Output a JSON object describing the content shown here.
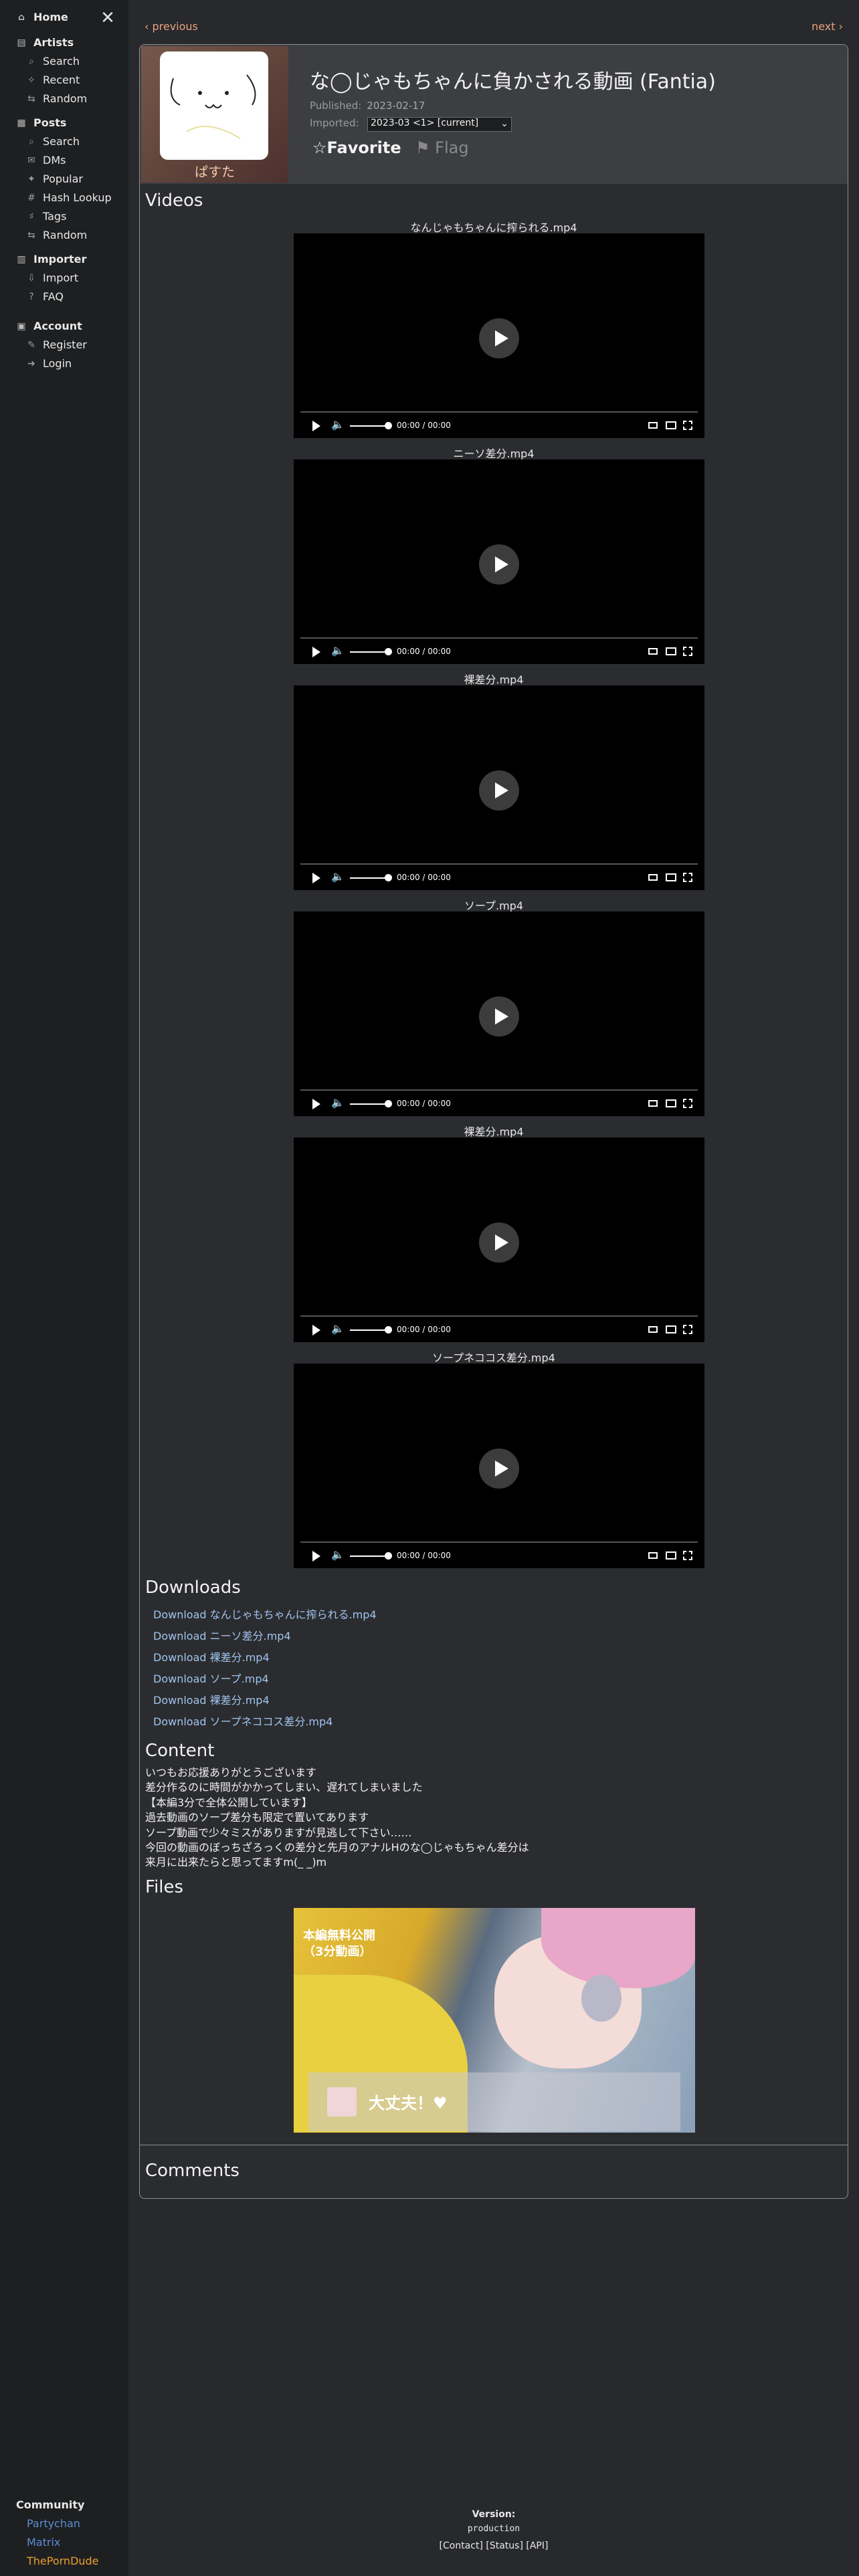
{
  "sidebar": {
    "home": "Home",
    "artists": {
      "label": "Artists",
      "items": [
        "Search",
        "Recent",
        "Random"
      ]
    },
    "posts": {
      "label": "Posts",
      "items": [
        "Search",
        "DMs",
        "Popular",
        "Hash Lookup",
        "Tags",
        "Random"
      ]
    },
    "importer": {
      "label": "Importer",
      "items": [
        "Import",
        "FAQ"
      ]
    },
    "account": {
      "label": "Account",
      "items": [
        "Register",
        "Login"
      ]
    },
    "community": {
      "label": "Community",
      "links": [
        {
          "label": "Partychan",
          "color": "#5a8ed6"
        },
        {
          "label": "Matrix",
          "color": "#5a8ed6"
        },
        {
          "label": "ThePornDude",
          "color": "#e8a030"
        }
      ]
    }
  },
  "nav": {
    "previous": "‹ previous",
    "next": "next ›"
  },
  "post": {
    "artist_name": "ぱすた",
    "title": "な◯じゃもちゃんに負かされる動画 (Fantia)",
    "published_label": "Published:",
    "published_date": "2023-02-17",
    "imported_label": "Imported:",
    "imported_value": "2023-03 <1> [current]",
    "favorite_label": "☆Favorite",
    "flag_label": "⚑ Flag"
  },
  "videos_heading": "Videos",
  "videos": [
    {
      "title": "なんじゃもちゃんに搾られる.mp4",
      "time": "00:00 / 00:00"
    },
    {
      "title": "ニーソ差分.mp4",
      "time": "00:00 / 00:00"
    },
    {
      "title": "裸差分.mp4",
      "time": "00:00 / 00:00"
    },
    {
      "title": "ソープ.mp4",
      "time": "00:00 / 00:00"
    },
    {
      "title": "裸差分.mp4",
      "time": "00:00 / 00:00"
    },
    {
      "title": "ソープネココス差分.mp4",
      "time": "00:00 / 00:00"
    }
  ],
  "downloads_heading": "Downloads",
  "downloads": [
    "Download なんじゃもちゃんに搾られる.mp4",
    "Download ニーソ差分.mp4",
    "Download 裸差分.mp4",
    "Download ソープ.mp4",
    "Download 裸差分.mp4",
    "Download ソープネココス差分.mp4"
  ],
  "content_heading": "Content",
  "content_lines": [
    "いつもお応援ありがとうございます",
    "差分作るのに時間がかかってしまい、遅れてしまいました",
    "【本編3分で全体公開しています】",
    "過去動画のソープ差分も限定で置いてあります",
    "ソープ動画で少々ミスがありますが見逃して下さい……",
    "今回の動画のぼっちざろっくの差分と先月のアナルHのな◯じゃもちゃん差分は",
    "来月に出来たらと思ってますm(_ _)m"
  ],
  "files_heading": "Files",
  "file_thumb": {
    "caption_line1": "本編無料公開",
    "caption_line2": "（3分動画）",
    "banner_text": "大丈夫！♥"
  },
  "comments_heading": "Comments",
  "footer": {
    "version_label": "Version:",
    "version_value": "production",
    "links": "[Contact]  [Status]  [API]"
  }
}
